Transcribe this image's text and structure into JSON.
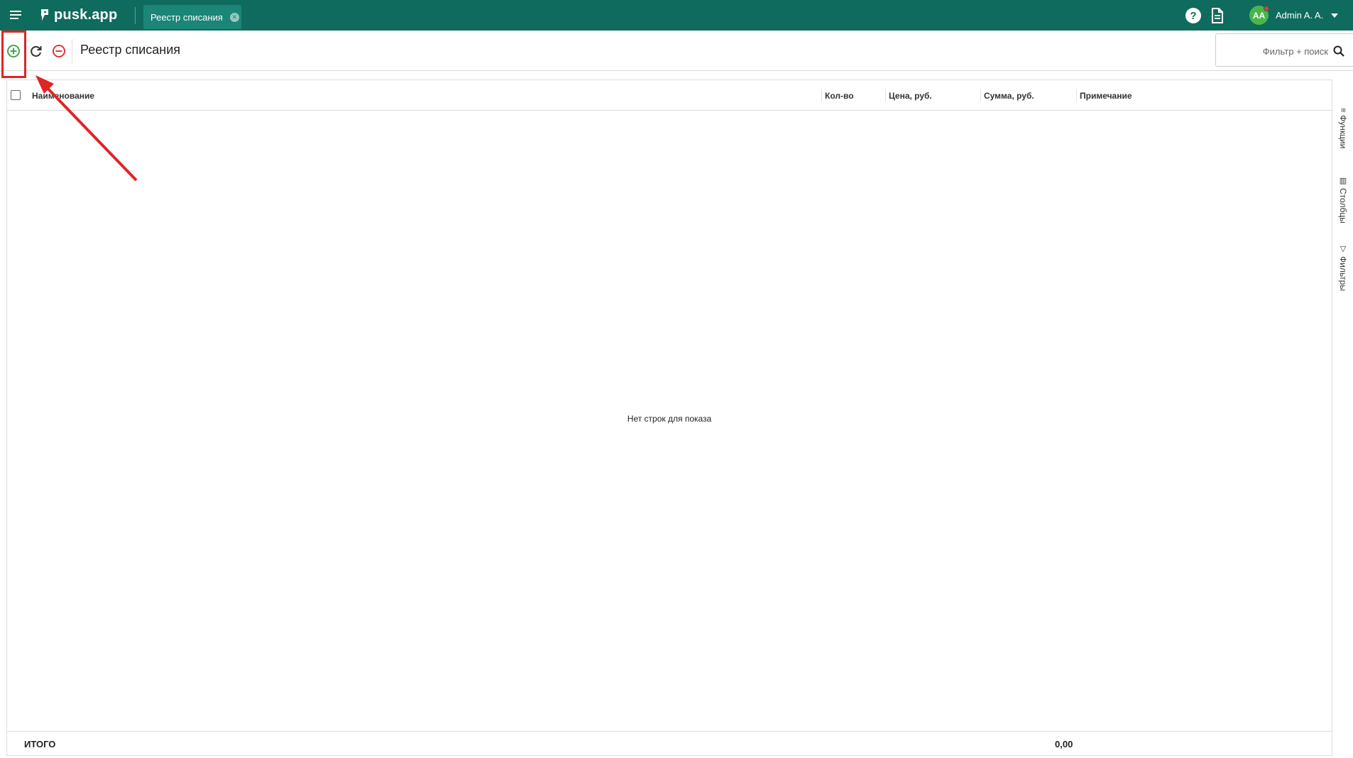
{
  "topbar": {
    "logo_text": "pusk.app",
    "tab_label": "Реестр списания",
    "help_glyph": "?",
    "avatar_initials": "AA",
    "user_name": "Admin A. A.",
    "colors": {
      "bar": "#0f6b5e",
      "tab": "#1b8577",
      "avatar": "#49b649",
      "notify_dot": "#e53935"
    }
  },
  "toolbar": {
    "page_title": "Реестр списания",
    "add_icon": "plus-circle-icon",
    "refresh_icon": "refresh-icon",
    "remove_icon": "minus-circle-icon",
    "search_placeholder": "Фильтр + поиск"
  },
  "grid": {
    "columns": [
      {
        "label": "Наименование"
      },
      {
        "label": "Кол-во"
      },
      {
        "label": "Цена, руб."
      },
      {
        "label": "Сумма, руб."
      },
      {
        "label": "Примечание"
      }
    ],
    "empty_message": "Нет строк для показа",
    "footer": {
      "label": "ИТОГО",
      "sum": "0,00"
    }
  },
  "side_panel": {
    "tabs": [
      {
        "label": "Функции",
        "glyph": "≡"
      },
      {
        "label": "Столбцы",
        "glyph": "▥"
      },
      {
        "label": "Фильтры",
        "glyph": "▽"
      }
    ]
  },
  "annotation": {
    "color": "#e02424"
  }
}
